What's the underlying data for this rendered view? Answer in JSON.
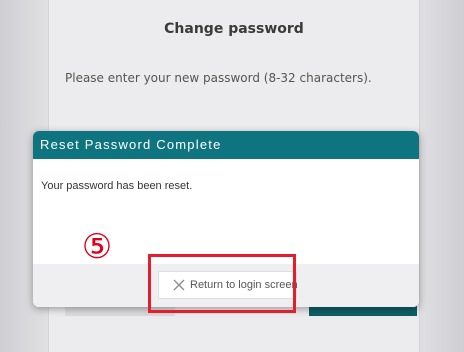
{
  "background_page": {
    "title": "Change password",
    "instruction": "Please enter your new password (8-32 characters)."
  },
  "dialog": {
    "title": "Reset Password Complete",
    "message": "Your password has been reset.",
    "return_button": {
      "label": "Return to login screen",
      "icon": "close-icon"
    },
    "header_color": "#0e7480"
  },
  "annotation": {
    "step_number": "⑤",
    "highlight_color": "#e41e2b"
  }
}
